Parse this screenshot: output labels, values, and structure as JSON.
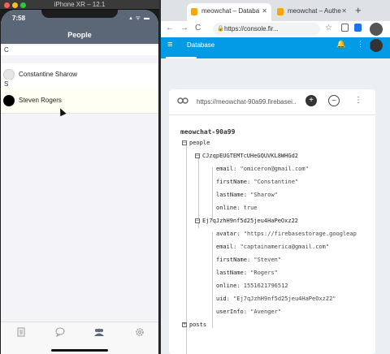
{
  "simulator": {
    "title": "iPhone XR – 12.1",
    "clock": "7:58",
    "status": "▴ ᯤ ▬"
  },
  "app": {
    "nav_title": "People",
    "sections": [
      {
        "letter": "C",
        "people": [
          {
            "name": "Constantine Sharow",
            "avatar": "gray"
          }
        ]
      },
      {
        "letter": "S",
        "people": [
          {
            "name": "Steven Rogers",
            "avatar": "black"
          }
        ]
      }
    ],
    "tabs": [
      "document-icon",
      "chat-icon",
      "people-icon",
      "settings-icon"
    ]
  },
  "browser": {
    "tabs": [
      {
        "title": "meowchat – Databa",
        "close": "✕"
      },
      {
        "title": "meowchat – Authe",
        "close": "✕"
      }
    ],
    "new_tab": "+",
    "url": "https://console.fir...",
    "lock": "🔒",
    "back": "←",
    "forward": "→",
    "reload": "C",
    "star": "☆"
  },
  "firebase": {
    "header_title": "Database",
    "menu": "≡",
    "bell": "🔔",
    "more": "⋮",
    "db_url": "https://meowchat-90a99.firebasei...",
    "add": "+",
    "remove": "−",
    "card_more": "⋮",
    "root": "meowchat-90a99",
    "collapse_sym": "–",
    "expand_sym": "+",
    "people_key": "people",
    "posts_key": "posts",
    "users": [
      {
        "id": "CJzqpEUGTEMTcUHeGQUVKL8WHGd2",
        "fields": [
          {
            "key": "email",
            "value": "\"omiceron@gmail.com\""
          },
          {
            "key": "firstName",
            "value": "\"Constantine\""
          },
          {
            "key": "lastName",
            "value": "\"Sharow\""
          },
          {
            "key": "online",
            "value": "true"
          }
        ]
      },
      {
        "id": "Ej7qJzhH9nf5d25jeu4HaPeOxz22",
        "fields": [
          {
            "key": "avatar",
            "value": "\"https://firebasestorage.googleap"
          },
          {
            "key": "email",
            "value": "\"captainamerica@gmail.com\""
          },
          {
            "key": "firstName",
            "value": "\"Steven\""
          },
          {
            "key": "lastName",
            "value": "\"Rogers\""
          },
          {
            "key": "online",
            "value": "1551621796512"
          },
          {
            "key": "uid",
            "value": "\"Ej7qJzhH9nf5d25jeu4HaPeOxz22\""
          },
          {
            "key": "userInfo",
            "value": "\"Avenger\""
          }
        ]
      }
    ]
  },
  "colors": {
    "firebase_blue": "#039be5",
    "nav": "#5b6677"
  }
}
